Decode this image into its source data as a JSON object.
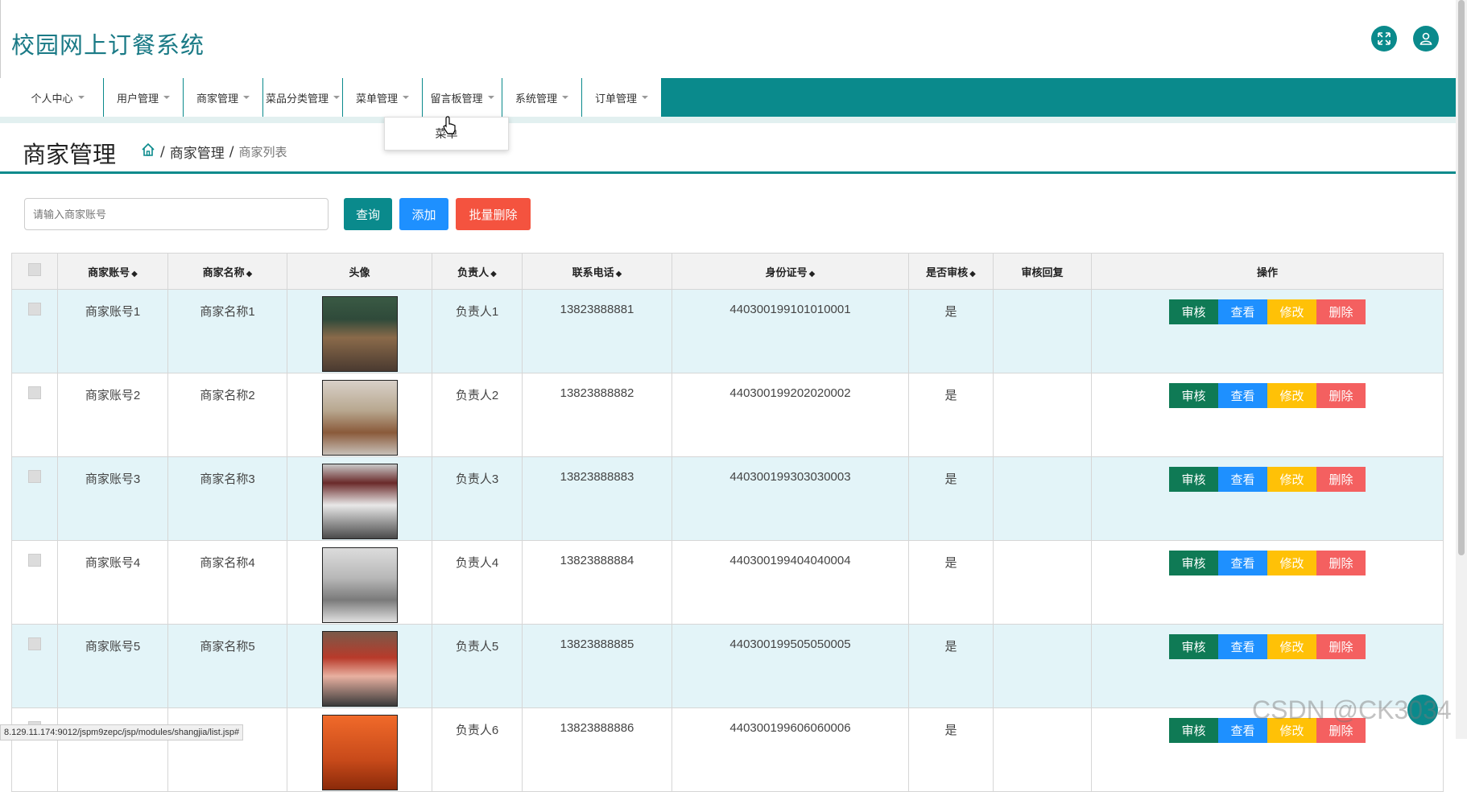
{
  "app": {
    "title": "校园网上订餐系统"
  },
  "nav": {
    "items": [
      {
        "label": "个人中心"
      },
      {
        "label": "用户管理"
      },
      {
        "label": "商家管理"
      },
      {
        "label": "菜品分类管理"
      },
      {
        "label": "菜单管理"
      },
      {
        "label": "留言板管理"
      },
      {
        "label": "系统管理"
      },
      {
        "label": "订单管理"
      }
    ],
    "dropdown": {
      "label": "菜单"
    }
  },
  "page": {
    "title": "商家管理",
    "breadcrumb": {
      "sep1": "/",
      "section": "商家管理",
      "sep2": "/",
      "current": "商家列表"
    }
  },
  "search": {
    "placeholder": "请输入商家账号"
  },
  "buttons": {
    "query": "查询",
    "add": "添加",
    "batch_delete": "批量删除"
  },
  "colors": {
    "accent": "#0a8a8c",
    "query": "#0a8a8c",
    "add": "#1e90ff",
    "batch_delete": "#f4533f",
    "op_audit": "#0f7a55",
    "op_view": "#1e90ff",
    "op_edit": "#ffc107",
    "op_delete": "#f46060"
  },
  "table": {
    "headers": {
      "account": "商家账号",
      "name": "商家名称",
      "avatar": "头像",
      "person": "负责人",
      "phone": "联系电话",
      "idcard": "身份证号",
      "audited": "是否审核",
      "reply": "审核回复",
      "ops": "操作"
    },
    "sort_icon": "◆",
    "rows": [
      {
        "account": "商家账号1",
        "name": "商家名称1",
        "person": "负责人1",
        "phone": "13823888881",
        "idcard": "440300199101010001",
        "audited": "是",
        "reply": ""
      },
      {
        "account": "商家账号2",
        "name": "商家名称2",
        "person": "负责人2",
        "phone": "13823888882",
        "idcard": "440300199202020002",
        "audited": "是",
        "reply": ""
      },
      {
        "account": "商家账号3",
        "name": "商家名称3",
        "person": "负责人3",
        "phone": "13823888883",
        "idcard": "440300199303030003",
        "audited": "是",
        "reply": ""
      },
      {
        "account": "商家账号4",
        "name": "商家名称4",
        "person": "负责人4",
        "phone": "13823888884",
        "idcard": "440300199404040004",
        "audited": "是",
        "reply": ""
      },
      {
        "account": "商家账号5",
        "name": "商家名称5",
        "person": "负责人5",
        "phone": "13823888885",
        "idcard": "440300199505050005",
        "audited": "是",
        "reply": ""
      },
      {
        "account": "",
        "name": "",
        "person": "负责人6",
        "phone": "13823888886",
        "idcard": "440300199606060006",
        "audited": "是",
        "reply": ""
      }
    ],
    "ops": {
      "audit": "审核",
      "view": "查看",
      "edit": "修改",
      "delete": "删除"
    }
  },
  "statusbar": {
    "url": "8.129.11.174:9012/jspm9zepc/jsp/modules/shangjia/list.jsp#"
  },
  "watermark": "CSDN @CK3034"
}
